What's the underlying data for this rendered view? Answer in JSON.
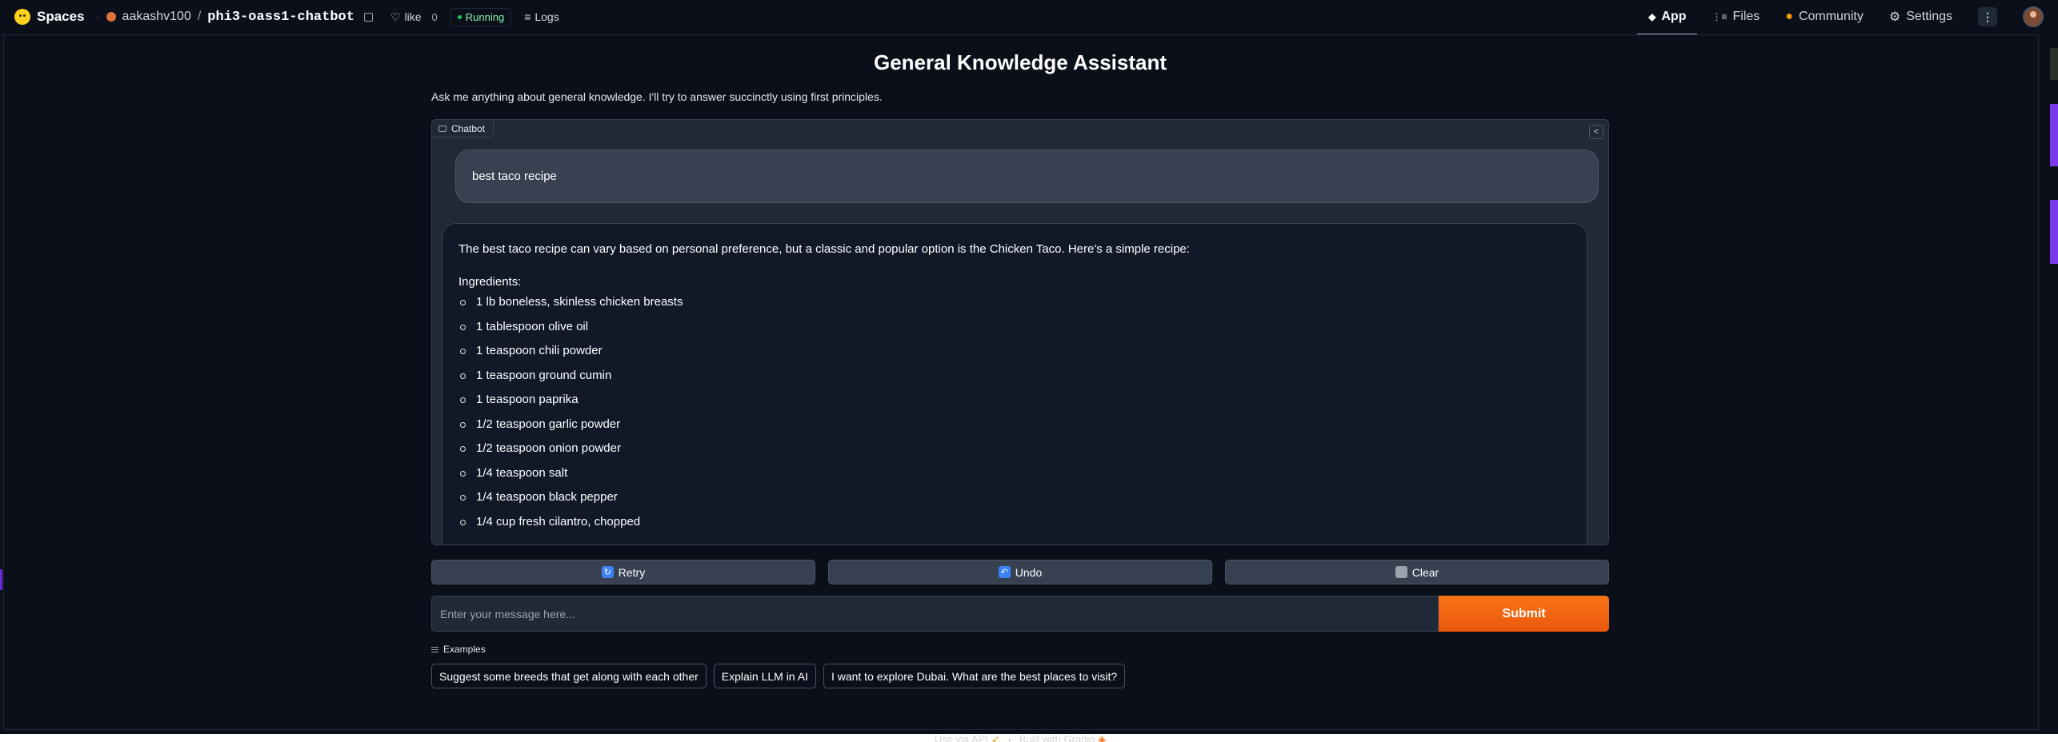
{
  "topbar": {
    "spaces_label": "Spaces",
    "owner": "aakashv100",
    "separator": "/",
    "repo": "phi3-oass1-chatbot",
    "like_label": "like",
    "like_count": "0",
    "status": "Running",
    "logs_label": "Logs",
    "tabs": [
      {
        "label": "App",
        "icon": "app-cube-icon",
        "active": true
      },
      {
        "label": "Files",
        "icon": "files-icon",
        "active": false
      },
      {
        "label": "Community",
        "icon": "community-icon",
        "active": false
      },
      {
        "label": "Settings",
        "icon": "gear-icon",
        "active": false
      }
    ],
    "menu_label": "⋮"
  },
  "app": {
    "title": "General Knowledge Assistant",
    "description": "Ask me anything about general knowledge. I'll try to answer succinctly using first principles."
  },
  "chatbot": {
    "label": "Chatbot",
    "user_message": "best taco recipe",
    "bot_intro": "The best taco recipe can vary based on personal preference, but a classic and popular option is the Chicken Taco. Here's a simple recipe:",
    "bot_heading": "Ingredients:",
    "ingredients": [
      "1 lb boneless, skinless chicken breasts",
      "1 tablespoon olive oil",
      "1 teaspoon chili powder",
      "1 teaspoon ground cumin",
      "1 teaspoon paprika",
      "1/2 teaspoon garlic powder",
      "1/2 teaspoon onion powder",
      "1/4 teaspoon salt",
      "1/4 teaspoon black pepper",
      "1/4 cup fresh cilantro, chopped"
    ]
  },
  "actions": {
    "retry": "Retry",
    "undo": "Undo",
    "clear": "Clear"
  },
  "input": {
    "placeholder": "Enter your message here...",
    "value": "",
    "submit": "Submit"
  },
  "examples": {
    "label": "Examples",
    "items": [
      "Suggest some breeds that get along with each other",
      "Explain LLM in AI",
      "I want to explore Dubai. What are the best places to visit?"
    ]
  },
  "footer": {
    "api_label": "Use via API",
    "separator": "·",
    "built_label": "Built with Gradio"
  },
  "colors": {
    "background": "#0b0f19",
    "panel": "#1f2937",
    "accent": "#f97316",
    "running": "#22c55e"
  }
}
